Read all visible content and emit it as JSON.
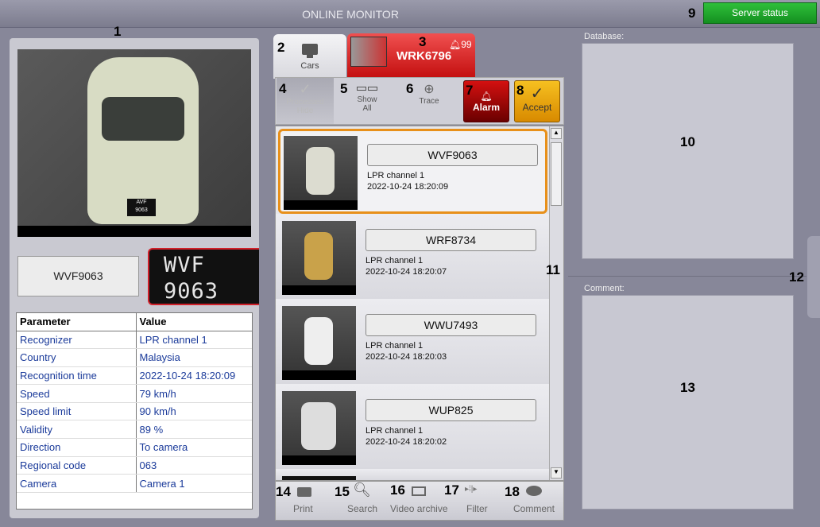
{
  "header": {
    "title": "ONLINE MONITOR",
    "server_status": "Server status"
  },
  "callouts": {
    "n1": "1",
    "n2": "2",
    "n3": "3",
    "n4": "4",
    "n5": "5",
    "n6": "6",
    "n7": "7",
    "n8": "8",
    "n9": "9",
    "n10": "10",
    "n11": "11",
    "n12": "12",
    "n13": "13",
    "n14": "14",
    "n15": "15",
    "n16": "16",
    "n17": "17",
    "n18": "18"
  },
  "recognition": {
    "plate": "WVF9063",
    "crop_line1": "WVF",
    "crop_line2": "9063",
    "camera_plate_l1": "AVF",
    "camera_plate_l2": "9063"
  },
  "params": {
    "headers": [
      "Parameter",
      "Value"
    ],
    "rows": [
      [
        "Recognizer",
        "LPR channel  1"
      ],
      [
        "Country",
        "Malaysia"
      ],
      [
        "Recognition time",
        "2022-10-24 18:20:09"
      ],
      [
        "Speed",
        "79 km/h"
      ],
      [
        "Speed limit",
        "90 km/h"
      ],
      [
        "Validity",
        "89 %"
      ],
      [
        "Direction",
        "To camera"
      ],
      [
        "Regional code",
        "063"
      ],
      [
        "Camera",
        "Camera 1"
      ]
    ]
  },
  "tabs": {
    "cars": "Cars",
    "alarm_plate": "WRK6796",
    "alarm_count": "99"
  },
  "toolbar": {
    "processed": "Processed",
    "hide": "Hide",
    "show": "Show",
    "all": "All",
    "trace": "Trace",
    "alarm": "Alarm",
    "accept": "Accept"
  },
  "list": [
    {
      "plate": "WVF9063",
      "channel": "LPR channel  1",
      "time": "2022-10-24 18:20:09"
    },
    {
      "plate": "WRF8734",
      "channel": "LPR channel  1",
      "time": "2022-10-24 18:20:07"
    },
    {
      "plate": "WWU7493",
      "channel": "LPR channel  1",
      "time": "2022-10-24 18:20:03"
    },
    {
      "plate": "WUP825",
      "channel": "LPR channel  1",
      "time": "2022-10-24 18:20:02"
    }
  ],
  "bottom": {
    "print": "Print",
    "search": "Search",
    "video": "Video archive",
    "filter": "Filter",
    "comment": "Comment"
  },
  "right": {
    "database": "Database:",
    "comment": "Comment:"
  },
  "colors": {
    "accent_green": "#149020",
    "alarm_red": "#c41010",
    "accept_orange": "#e8a010",
    "selected": "#e8901a"
  }
}
